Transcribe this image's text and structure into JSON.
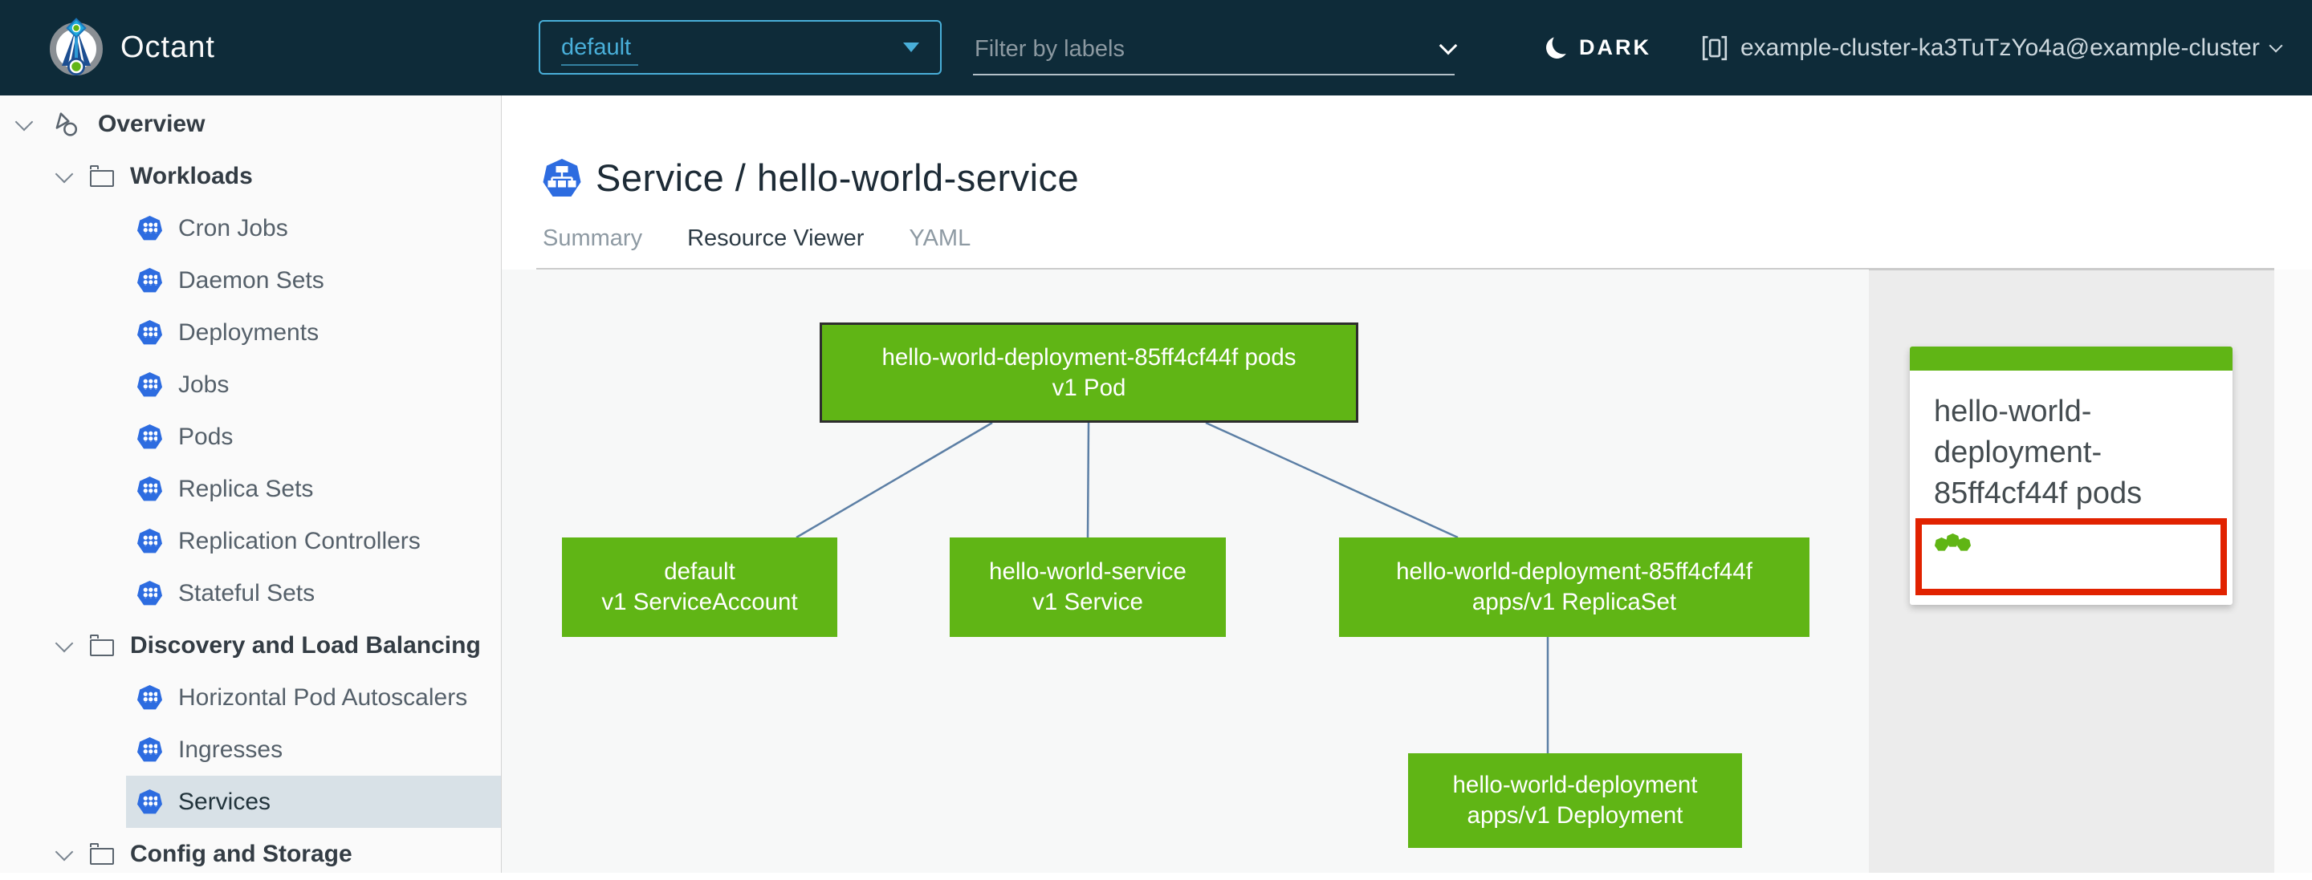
{
  "header": {
    "brand": "Octant",
    "namespace_dropdown": {
      "value": "default"
    },
    "filter_input": {
      "placeholder": "Filter by labels"
    },
    "theme_toggle": {
      "label": "DARK"
    },
    "context_selector": {
      "label": "example-cluster-ka3TuTzYo4a@example-cluster"
    }
  },
  "sidebar": {
    "items": [
      {
        "label": "Overview",
        "type": "root",
        "selected": false
      },
      {
        "label": "Workloads",
        "type": "group",
        "selected": false
      },
      {
        "label": "Cron Jobs",
        "type": "leaf",
        "selected": false
      },
      {
        "label": "Daemon Sets",
        "type": "leaf",
        "selected": false
      },
      {
        "label": "Deployments",
        "type": "leaf",
        "selected": false
      },
      {
        "label": "Jobs",
        "type": "leaf",
        "selected": false
      },
      {
        "label": "Pods",
        "type": "leaf",
        "selected": false
      },
      {
        "label": "Replica Sets",
        "type": "leaf",
        "selected": false
      },
      {
        "label": "Replication Controllers",
        "type": "leaf",
        "selected": false
      },
      {
        "label": "Stateful Sets",
        "type": "leaf",
        "selected": false
      },
      {
        "label": "Discovery and Load Balancing",
        "type": "group",
        "selected": false
      },
      {
        "label": "Horizontal Pod Autoscalers",
        "type": "leaf",
        "selected": false
      },
      {
        "label": "Ingresses",
        "type": "leaf",
        "selected": false
      },
      {
        "label": "Services",
        "type": "leaf",
        "selected": true
      },
      {
        "label": "Config and Storage",
        "type": "group",
        "selected": false
      }
    ]
  },
  "main": {
    "title": "Service / hello-world-service",
    "tabs": [
      {
        "label": "Summary",
        "active": false
      },
      {
        "label": "Resource Viewer",
        "active": true
      },
      {
        "label": "YAML",
        "active": false
      }
    ]
  },
  "graph": {
    "nodes": [
      {
        "name": "hello-world-deployment-85ff4cf44f pods",
        "kind": "v1 Pod",
        "selected": true
      },
      {
        "name": "default",
        "kind": "v1 ServiceAccount",
        "selected": false
      },
      {
        "name": "hello-world-service",
        "kind": "v1 Service",
        "selected": false
      },
      {
        "name": "hello-world-deployment-85ff4cf44f",
        "kind": "apps/v1 ReplicaSet",
        "selected": false
      },
      {
        "name": "hello-world-deployment",
        "kind": "apps/v1 Deployment",
        "selected": false
      }
    ],
    "edges": [
      [
        0,
        1
      ],
      [
        0,
        2
      ],
      [
        0,
        3
      ],
      [
        3,
        4
      ]
    ]
  },
  "detail_panel": {
    "card": {
      "title": "hello-world-deployment-85ff4cf44f pods",
      "pod_status_dots": 3
    }
  },
  "colors": {
    "topbar_bg": "#0e2b39",
    "accent_blue": "#49afd9",
    "k8s_icon_blue": "#2d6ce0",
    "tab_active_blue": "#0079b8",
    "node_green": "#60b515",
    "edge_steel": "#5c7fa5",
    "highlight_red": "#e12200",
    "selected_row_bg": "#d8e1e7"
  }
}
